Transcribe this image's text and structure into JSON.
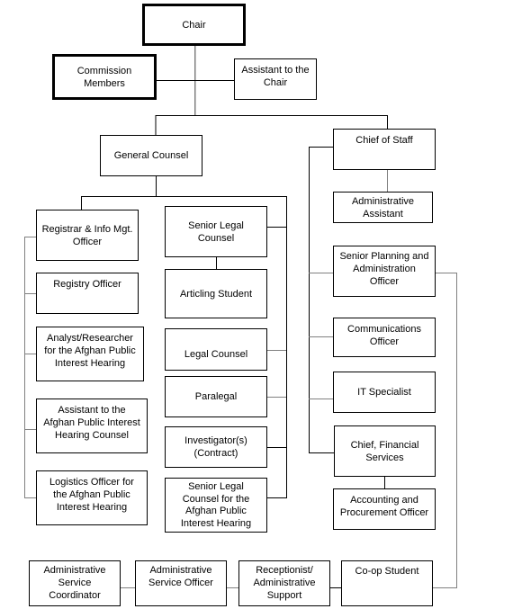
{
  "chart": {
    "chair": "Chair",
    "commission_members": "Commission\nMembers",
    "assistant_to_chair": "Assistant to the\nChair",
    "general_counsel": "General Counsel",
    "chief_of_staff": "Chief of Staff",
    "left_column": [
      "Registrar & Info Mgt.\nOfficer",
      "Registry Officer",
      "Analyst/Researcher\nfor the Afghan Public\nInterest Hearing",
      "Assistant to the\nAfghan Public Interest\nHearing Counsel",
      "Logistics Officer for\nthe Afghan Public\nInterest Hearing"
    ],
    "middle_column": [
      "Senior Legal\nCounsel",
      "Articling Student",
      "Legal Counsel",
      "Paralegal",
      "Investigator(s)\n(Contract)",
      "Senior Legal\nCounsel for the\nAfghan Public\nInterest Hearing"
    ],
    "right_column": [
      "Administrative\nAssistant",
      "Senior Planning and\nAdministration\nOfficer",
      "Communications\nOfficer",
      "IT Specialist",
      "Chief, Financial\nServices",
      "Accounting and\nProcurement Officer"
    ],
    "bottom_row": [
      "Administrative\nService\nCoordinator",
      "Administrative\nService Officer",
      "Receptionist/\nAdministrative\nSupport",
      "Co-op Student"
    ]
  }
}
